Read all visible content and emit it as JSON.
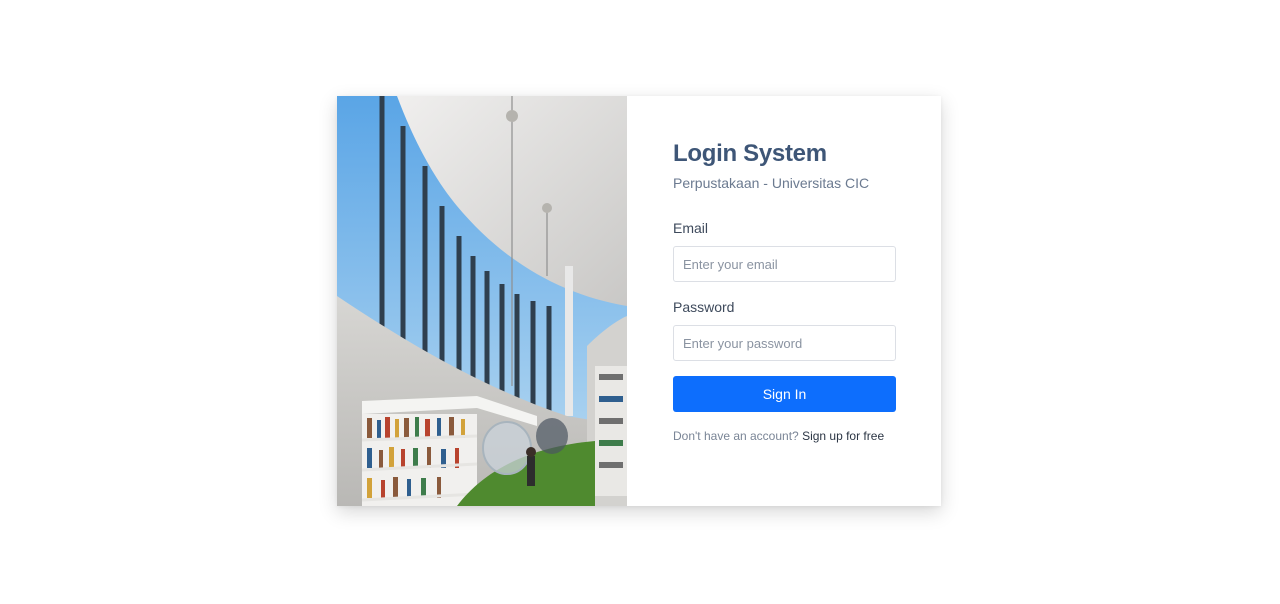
{
  "login": {
    "title": "Login System",
    "subtitle": "Perpustakaan - Universitas CIC",
    "email": {
      "label": "Email",
      "value": "",
      "placeholder": "Enter your email"
    },
    "password": {
      "label": "Password",
      "value": "",
      "placeholder": "Enter your password"
    },
    "submit_label": "Sign In",
    "signup_prompt": "Don't have an account?",
    "signup_link": "Sign up for free"
  },
  "colors": {
    "title": "#3e5677",
    "primary_button": "#0d6efd",
    "background": "#ffffff"
  }
}
